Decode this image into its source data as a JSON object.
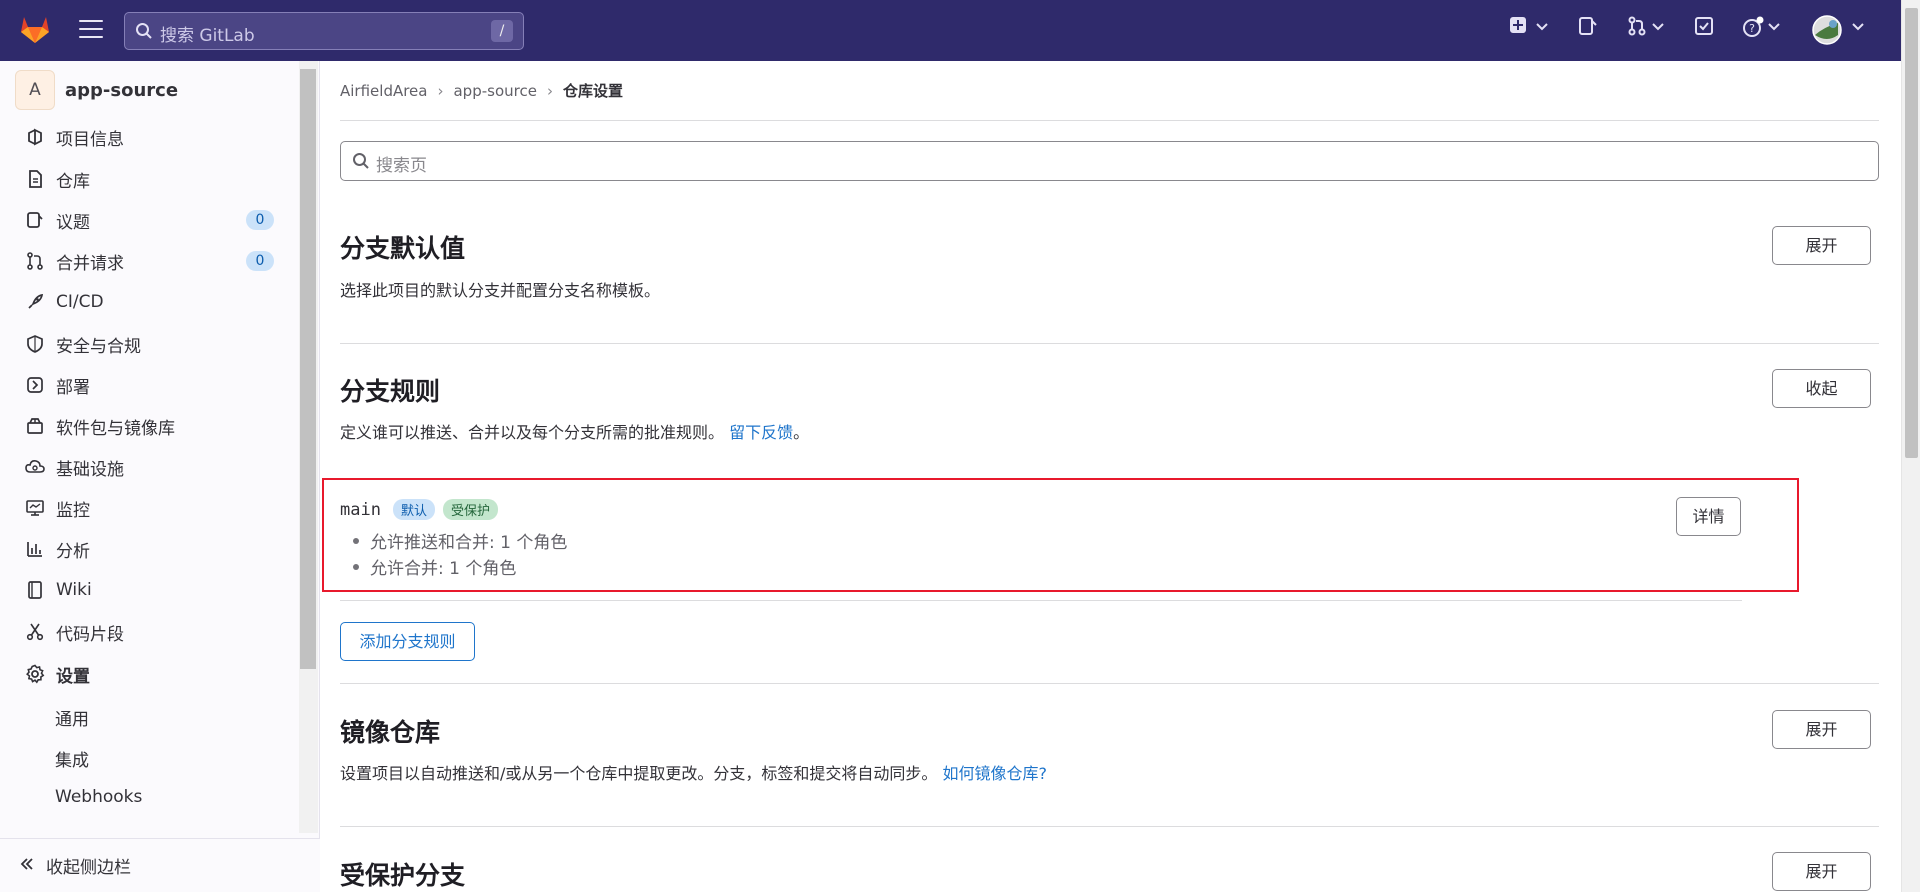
{
  "topbar": {
    "search_placeholder": "搜索 GitLab",
    "search_shortcut": "/"
  },
  "sidebar": {
    "project_avatar": "A",
    "project_name": "app-source",
    "items": [
      {
        "label": "项目信息",
        "icon": "info-icon"
      },
      {
        "label": "仓库",
        "icon": "file-icon"
      },
      {
        "label": "议题",
        "icon": "issues-icon",
        "count": "0"
      },
      {
        "label": "合并请求",
        "icon": "merge-request-icon",
        "count": "0"
      },
      {
        "label": "CI/CD",
        "icon": "rocket-icon"
      },
      {
        "label": "安全与合规",
        "icon": "shield-icon"
      },
      {
        "label": "部署",
        "icon": "deploy-icon"
      },
      {
        "label": "软件包与镜像库",
        "icon": "package-icon"
      },
      {
        "label": "基础设施",
        "icon": "cloud-icon"
      },
      {
        "label": "监控",
        "icon": "monitor-icon"
      },
      {
        "label": "分析",
        "icon": "chart-icon"
      },
      {
        "label": "Wiki",
        "icon": "book-icon"
      },
      {
        "label": "代码片段",
        "icon": "snippet-icon"
      },
      {
        "label": "设置",
        "icon": "gear-icon"
      }
    ],
    "subitems": [
      "通用",
      "集成",
      "Webhooks"
    ],
    "collapse_label": "收起侧边栏"
  },
  "breadcrumb": [
    "AirfieldArea",
    "app-source",
    "仓库设置"
  ],
  "page_search_placeholder": "搜索页",
  "sections": {
    "branch_defaults": {
      "title": "分支默认值",
      "desc": "选择此项目的默认分支并配置分支名称模板。",
      "button": "展开"
    },
    "branch_rules": {
      "title": "分支规则",
      "desc": "定义谁可以推送、合并以及每个分支所需的批准规则。",
      "link": "留下反馈",
      "link_suffix": "。",
      "button": "收起",
      "rule": {
        "branch": "main",
        "badge_default": "默认",
        "badge_protected": "受保护",
        "details": [
          "允许推送和合并: 1 个角色",
          "允许合并: 1 个角色"
        ],
        "details_button": "详情"
      },
      "add_button": "添加分支规则"
    },
    "mirror": {
      "title": "镜像仓库",
      "desc": "设置项目以自动推送和/或从另一个仓库中提取更改。分支，标签和提交将自动同步。",
      "link": "如何镜像仓库?",
      "button": "展开"
    },
    "protected": {
      "title": "受保护分支",
      "button": "展开"
    }
  },
  "colors": {
    "navbar": "#2f2a6b",
    "link": "#1f75cb",
    "highlight": "#e8192c"
  }
}
